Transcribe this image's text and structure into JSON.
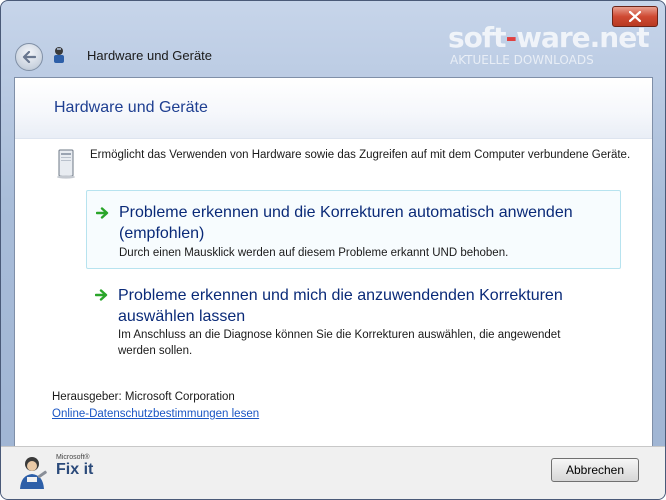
{
  "window": {
    "title": "Hardware und Geräte",
    "watermark_left": "soft",
    "watermark_accent": "-",
    "watermark_right": "ware.net",
    "watermark_sub": "AKTUELLE DOWNLOADS"
  },
  "header": {
    "heading": "Hardware und Geräte"
  },
  "intro": {
    "description": "Ermöglicht das Verwenden von Hardware sowie das Zugreifen auf mit dem Computer verbundene Geräte."
  },
  "options": [
    {
      "title": "Probleme erkennen und die Korrekturen automatisch anwenden (empfohlen)",
      "subtitle": "Durch einen Mausklick werden auf diesem Probleme erkannt UND behoben."
    },
    {
      "title": "Probleme erkennen und mich die anzuwendenden Korrekturen auswählen lassen",
      "subtitle": "Im Anschluss an die Diagnose können Sie die Korrekturen auswählen, die angewendet werden sollen."
    }
  ],
  "publisher": {
    "label": "Herausgeber: Microsoft Corporation",
    "privacy_link": "Online-Datenschutzbestimmungen lesen"
  },
  "footer": {
    "logo_small": "Microsoft®",
    "logo_main": "Fix it",
    "cancel_label": "Abbrechen"
  },
  "colors": {
    "heading": "#1e3f91",
    "option_title": "#0a2a78",
    "link": "#1a56c4",
    "arrow": "#2aa52a"
  }
}
